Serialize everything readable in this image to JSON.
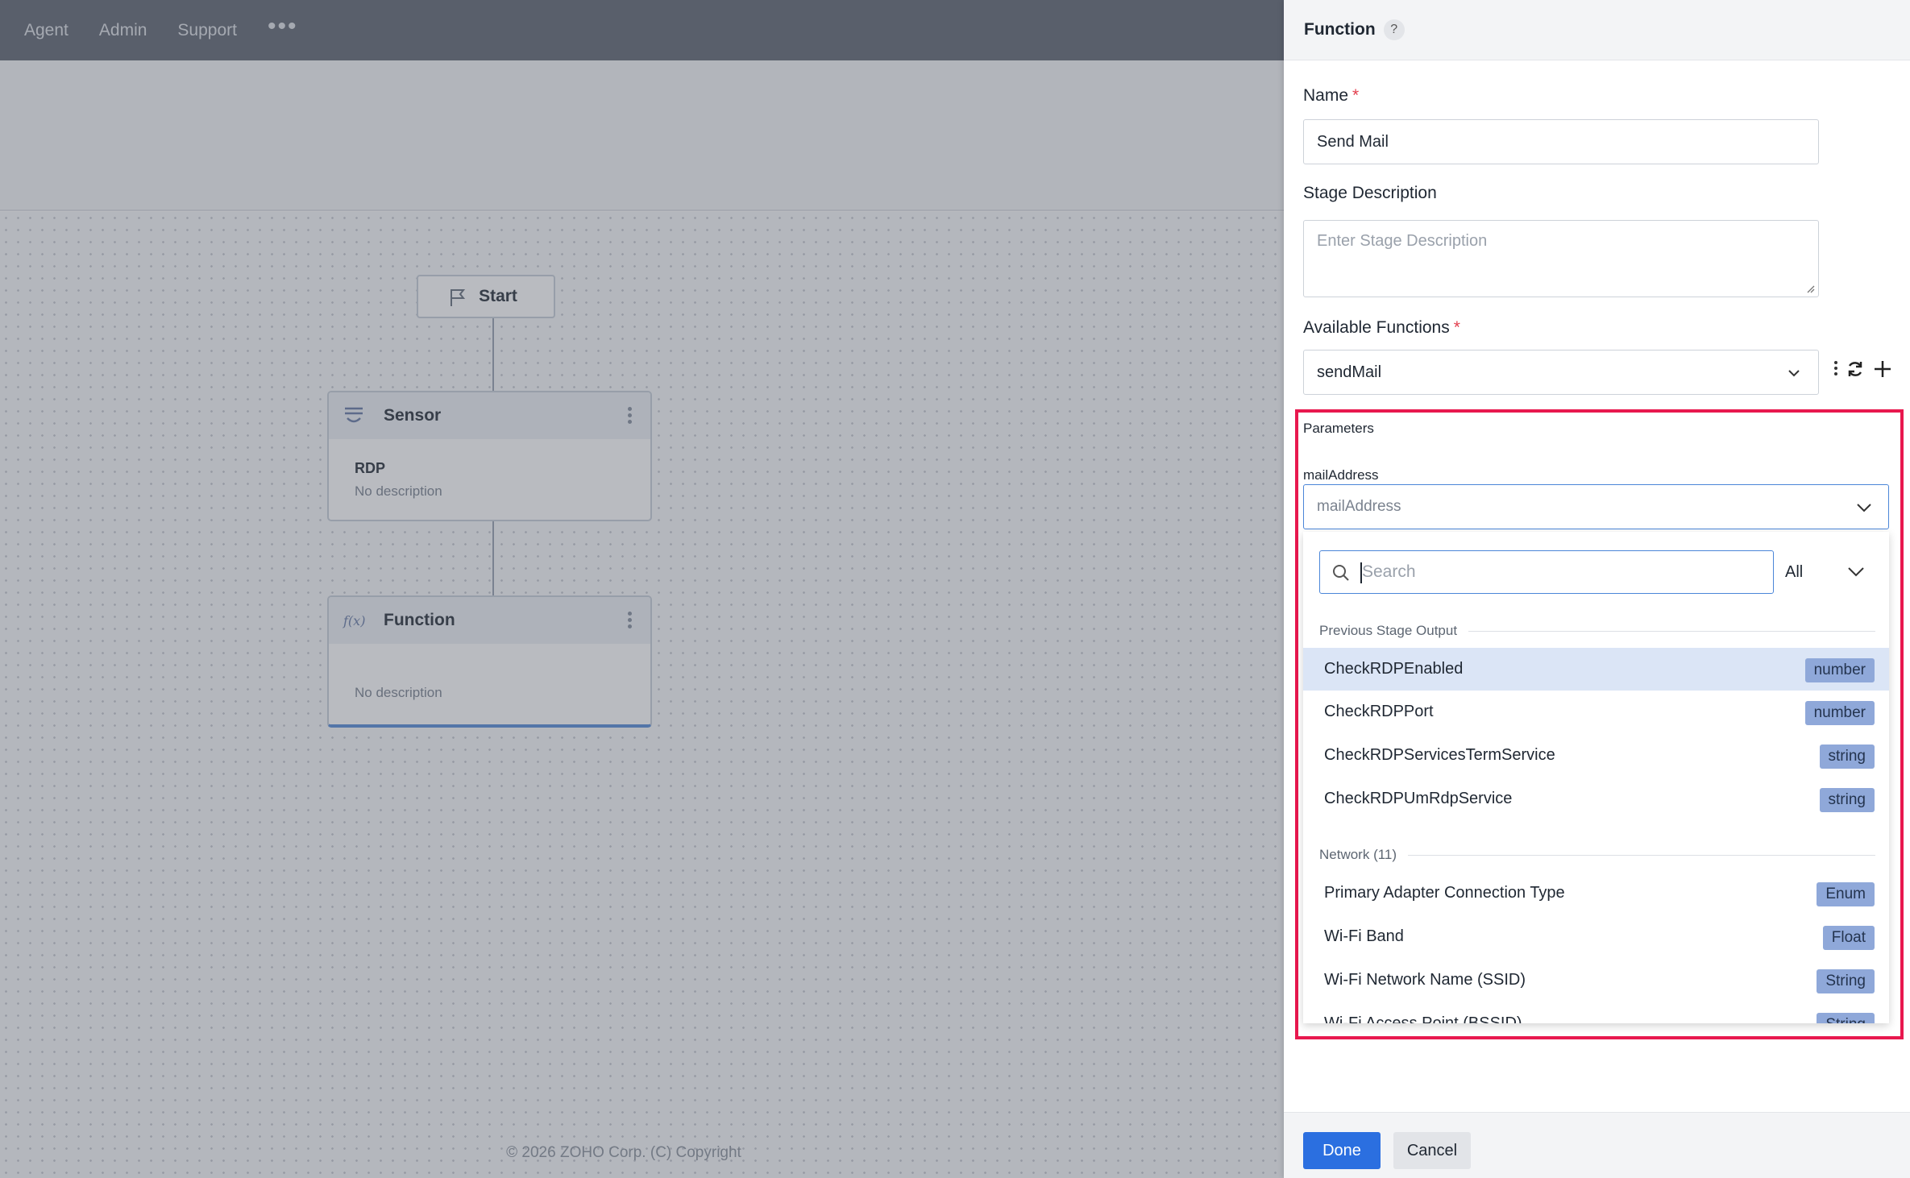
{
  "topnav": {
    "items": [
      "Agent",
      "Admin",
      "Support"
    ],
    "more": "•••"
  },
  "workflow": {
    "start": "Start",
    "stages": [
      {
        "title": "Sensor",
        "subtitle": "RDP",
        "description": "No description",
        "icon": "sensor-icon"
      },
      {
        "title": "Function",
        "subtitle": "",
        "description": "No description",
        "icon": "function-icon"
      }
    ],
    "copyright": "© 2026 ZOHO Corp. (C) Copyright"
  },
  "panel": {
    "title": "Function",
    "help": "?",
    "name_label": "Name",
    "name_value": "Send Mail",
    "stage_desc_label": "Stage Description",
    "stage_desc_placeholder": "Enter Stage Description",
    "functions_label": "Available Functions",
    "functions_value": "sendMail",
    "parameters_title": "Parameters",
    "param_label": "mailAddress",
    "param_placeholder": "mailAddress",
    "search_placeholder": "Search",
    "filter_value": "All",
    "groups": [
      {
        "label": "Previous Stage Output",
        "options": [
          {
            "name": "CheckRDPEnabled",
            "type": "number",
            "active": true
          },
          {
            "name": "CheckRDPPort",
            "type": "number"
          },
          {
            "name": "CheckRDPServicesTermService",
            "type": "string"
          },
          {
            "name": "CheckRDPUmRdpService",
            "type": "string"
          }
        ]
      },
      {
        "label": "Network (11)",
        "options": [
          {
            "name": "Primary Adapter Connection Type",
            "type": "Enum"
          },
          {
            "name": "Wi-Fi Band",
            "type": "Float"
          },
          {
            "name": "Wi-Fi Network Name (SSID)",
            "type": "String"
          },
          {
            "name": "Wi-Fi Access Point (BSSID)",
            "type": "String"
          }
        ]
      }
    ],
    "done": "Done",
    "cancel": "Cancel"
  },
  "colors": {
    "accent": "#2b6fe0",
    "highlight": "#e8184e",
    "badge": "#8fa8d9",
    "active_row": "#dbe5f6"
  }
}
